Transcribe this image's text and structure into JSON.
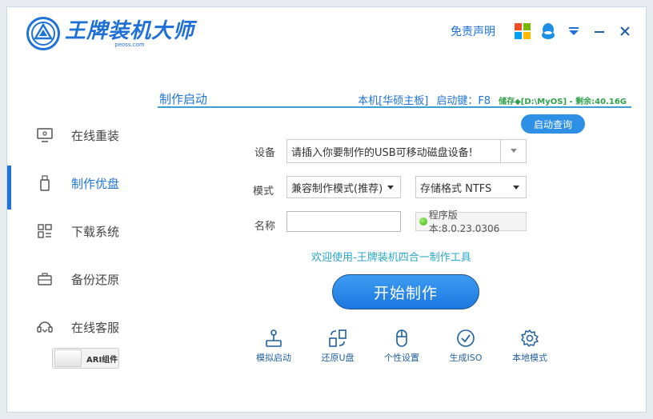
{
  "app": {
    "title": "王牌装机大师",
    "subtitle": "peoss.com"
  },
  "titlebar": {
    "disclaimer": "免责声明"
  },
  "sidebar": {
    "items": [
      {
        "label": "在线重装",
        "icon": "monitor-icon",
        "active": false
      },
      {
        "label": "制作优盘",
        "icon": "usb-drive-icon",
        "active": true
      },
      {
        "label": "下载系统",
        "icon": "grid-icon",
        "active": false
      },
      {
        "label": "备份还原",
        "icon": "briefcase-icon",
        "active": false
      },
      {
        "label": "在线客服",
        "icon": "headset-icon",
        "active": false
      }
    ],
    "ari_toggle_label": "ARI组件"
  },
  "section": {
    "title": "制作启动",
    "machine": "本机[华硕主板]",
    "boot_key": "启动键：F8",
    "storage": "储存◆[D:\\MyOS] - 剩余:40.16G"
  },
  "boot_query_button": "启动查询",
  "form": {
    "device_label": "设备",
    "device_value": "请插入你要制作的USB可移动磁盘设备!",
    "mode_label": "模式",
    "mode_value": "兼容制作模式(推荐)",
    "format_value": "存储格式 NTFS",
    "name_label": "名称",
    "name_value": "",
    "version": "程序版本:8.0.23.0306"
  },
  "welcome_text": "欢迎使用-王牌装机四合一制作工具",
  "start_button": "开始制作",
  "tools": [
    {
      "label": "模拟启动",
      "icon": "joystick-icon"
    },
    {
      "label": "还原U盘",
      "icon": "restore-icon"
    },
    {
      "label": "个性设置",
      "icon": "mouse-icon"
    },
    {
      "label": "生成ISO",
      "icon": "check-circle-icon"
    },
    {
      "label": "本地模式",
      "icon": "gear-icon"
    }
  ],
  "colors": {
    "accent": "#1e73d8",
    "section_line": "#3aa0d8",
    "storage_text": "#2ea14a",
    "welcome_text": "#2aa7c9"
  }
}
